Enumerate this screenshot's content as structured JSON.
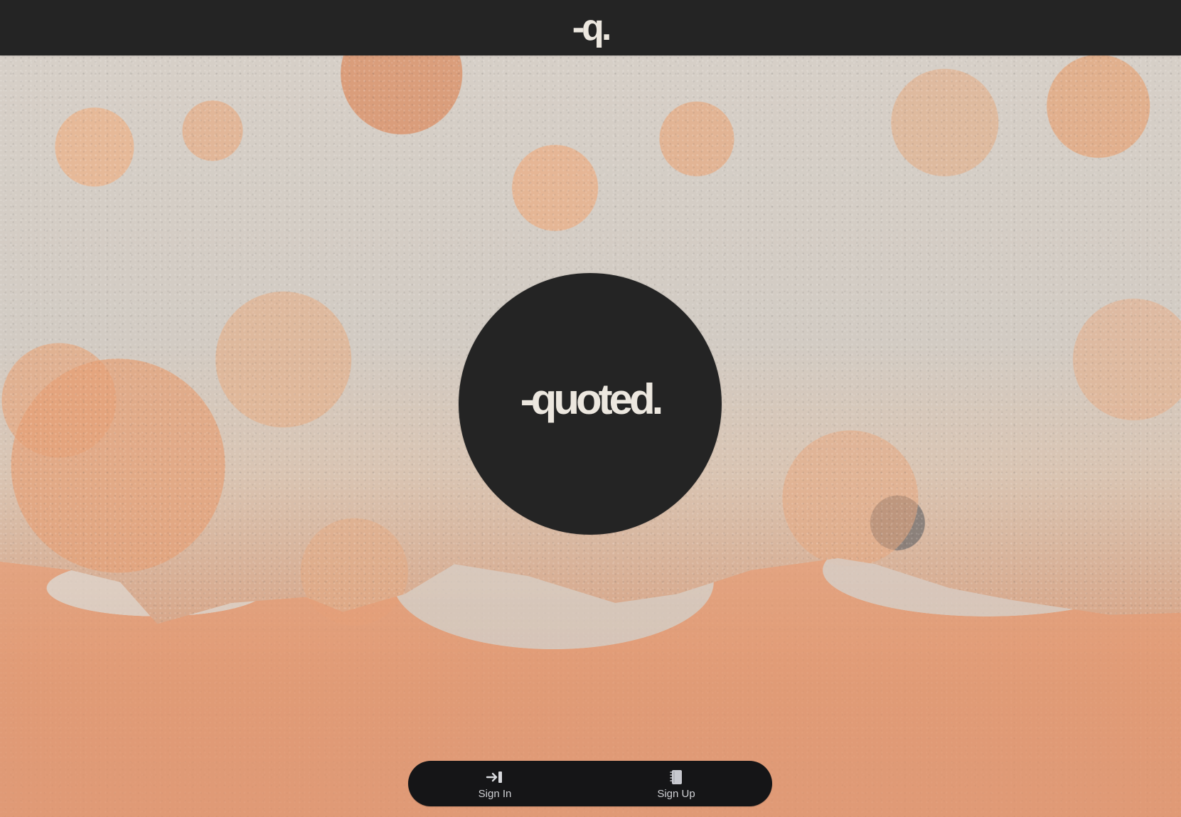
{
  "header": {
    "logo": "-q."
  },
  "hero": {
    "title": "-quoted."
  },
  "auth": {
    "sign_in": "Sign In",
    "sign_up": "Sign Up"
  },
  "icons": {
    "sign_in": "sign-in-arrow-icon",
    "sign_up": "notebook-icon"
  },
  "colors": {
    "dark": "#242424",
    "bar": "#151517",
    "logo_text": "#ece7df",
    "button_text": "#cfd0d4"
  }
}
